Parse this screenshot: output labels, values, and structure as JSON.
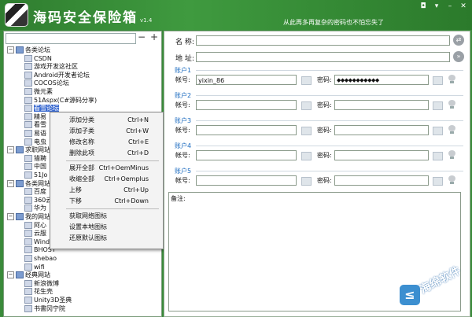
{
  "app": {
    "title": "海码安全保险箱",
    "version": "v1.4",
    "slogan": "从此再多再复杂的密码也不怕忘失了",
    "window_buttons": [
      "◘",
      "▾",
      "–",
      "✕"
    ]
  },
  "sidebar": {
    "search_placeholder": "",
    "minus": "−",
    "plus": "+",
    "tree": [
      {
        "label": "各类论坛",
        "type": "folder",
        "expanded": true
      },
      {
        "label": "CSDN",
        "type": "leaf"
      },
      {
        "label": "游戏开发这社区",
        "type": "leaf"
      },
      {
        "label": "Android开发者论坛",
        "type": "leaf"
      },
      {
        "label": "COCOS论坛",
        "type": "leaf"
      },
      {
        "label": "微元素",
        "type": "leaf"
      },
      {
        "label": "51Aspx(C#源码分享)",
        "type": "leaf"
      },
      {
        "label": "看雪论坛",
        "type": "leaf",
        "selected": true
      },
      {
        "label": "精易",
        "type": "leaf"
      },
      {
        "label": "看雪",
        "type": "leaf"
      },
      {
        "label": "易语",
        "type": "leaf"
      },
      {
        "label": "电虫",
        "type": "leaf"
      },
      {
        "label": "求职网站",
        "type": "folder",
        "expanded": true
      },
      {
        "label": "猎聘",
        "type": "leaf"
      },
      {
        "label": "中国",
        "type": "leaf"
      },
      {
        "label": "51Jo",
        "type": "leaf"
      },
      {
        "label": "各类网站",
        "type": "folder",
        "expanded": true
      },
      {
        "label": "百度",
        "type": "leaf"
      },
      {
        "label": "360云",
        "type": "leaf"
      },
      {
        "label": "华为",
        "type": "leaf"
      },
      {
        "label": "我的网站",
        "type": "folder",
        "expanded": true
      },
      {
        "label": "阿心",
        "type": "leaf"
      },
      {
        "label": "云服",
        "type": "leaf"
      },
      {
        "label": "Wind",
        "type": "leaf"
      },
      {
        "label": "BHOST",
        "type": "leaf"
      },
      {
        "label": "shebao",
        "type": "leaf"
      },
      {
        "label": "wifi",
        "type": "leaf"
      },
      {
        "label": "经典网站",
        "type": "folder",
        "expanded": true
      },
      {
        "label": "新浪微博",
        "type": "leaf"
      },
      {
        "label": "花生壳",
        "type": "leaf"
      },
      {
        "label": "Unity3D圣典",
        "type": "leaf"
      },
      {
        "label": "书書冈宁院",
        "type": "leaf"
      }
    ]
  },
  "context_menu": {
    "items": [
      {
        "label": "添加分类",
        "key": "Ctrl+N"
      },
      {
        "label": "添加子类",
        "key": "Ctrl+W"
      },
      {
        "label": "修改名称",
        "key": "Ctrl+E"
      },
      {
        "label": "删除此项",
        "key": "Ctrl+D"
      },
      {
        "label": "展开全部",
        "key": "Ctrl+OemMinus"
      },
      {
        "label": "收缩全部",
        "key": "Ctrl+Oemplus"
      },
      {
        "label": "上移",
        "key": "Ctrl+Up"
      },
      {
        "label": "下移",
        "key": "Ctrl+Down"
      },
      {
        "label": "获取网络图标",
        "key": ""
      },
      {
        "label": "设置本地图标",
        "key": ""
      },
      {
        "label": "还原默认图标",
        "key": ""
      }
    ]
  },
  "detail": {
    "name_label": "名 称:",
    "name_value": "",
    "url_label": "地 址:",
    "url_value": "",
    "accounts": [
      {
        "title": "账户1",
        "user_label": "帐号:",
        "user": "yixin_86",
        "pass_label": "密码:",
        "pass": "◆◆◆◆◆◆◆◆◆◆◆"
      },
      {
        "title": "账户2",
        "user_label": "帐号:",
        "user": "",
        "pass_label": "密码:",
        "pass": ""
      },
      {
        "title": "账户3",
        "user_label": "帐号:",
        "user": "",
        "pass_label": "密码:",
        "pass": ""
      },
      {
        "title": "账户4",
        "user_label": "帐号:",
        "user": "",
        "pass_label": "密码:",
        "pass": ""
      },
      {
        "title": "账户5",
        "user_label": "帐号:",
        "user": "",
        "pass_label": "密码:",
        "pass": ""
      }
    ],
    "note_label": "备注:"
  },
  "watermark": {
    "text": "海绵软件",
    "logo": "≤"
  }
}
